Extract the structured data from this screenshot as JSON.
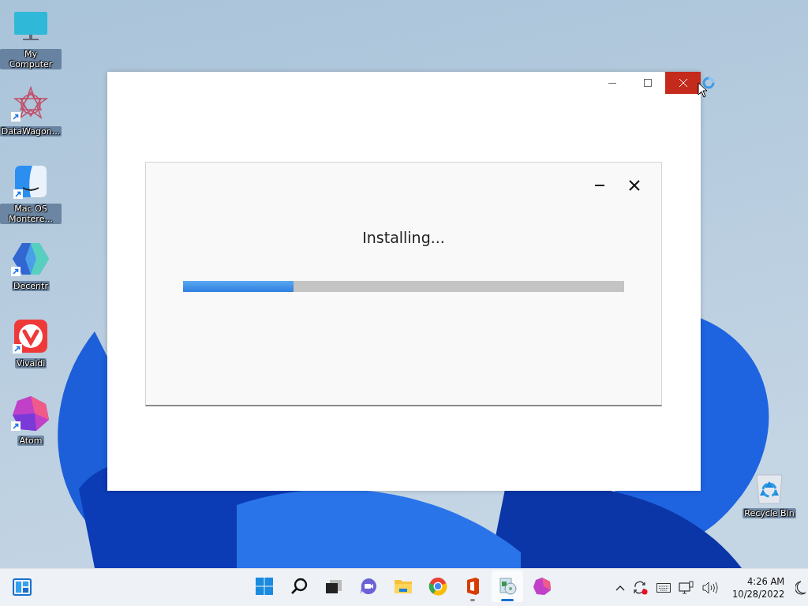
{
  "desktop_icons": [
    {
      "label": "My Computer",
      "shortcut": false
    },
    {
      "label": "DataWagon...",
      "shortcut": true
    },
    {
      "label": "Mac OS Montere...",
      "shortcut": true
    },
    {
      "label": "Decentr",
      "shortcut": true
    },
    {
      "label": "Vivaldi",
      "shortcut": true
    },
    {
      "label": "Atom",
      "shortcut": true
    }
  ],
  "recycle_bin": {
    "label": "Recycle Bin"
  },
  "installer": {
    "status": "Installing...",
    "progress": {
      "level": 0.25
    }
  },
  "taskbar": {
    "apps": [
      {
        "running": false,
        "active": false
      },
      {
        "running": false,
        "active": false
      },
      {
        "running": false,
        "active": false
      },
      {
        "running": false,
        "active": false
      },
      {
        "running": false,
        "active": false
      },
      {
        "running": false,
        "active": false
      },
      {
        "running": true,
        "active": false
      },
      {
        "running": true,
        "active": true
      },
      {
        "running": false,
        "active": false
      }
    ],
    "time": "4:26 AM",
    "date": "10/28/2022"
  }
}
